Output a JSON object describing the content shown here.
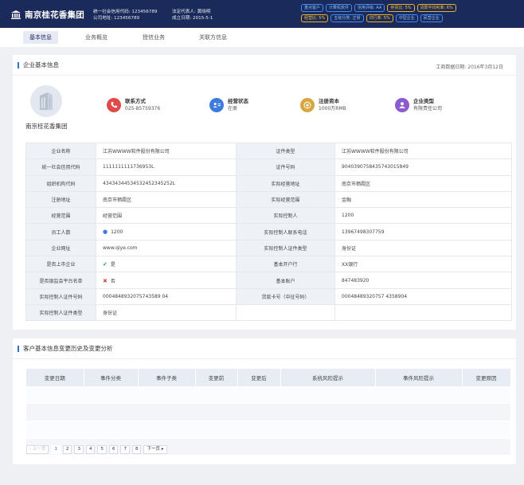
{
  "header": {
    "company": "南京桂花香集团",
    "credit_code": "统一社会信用代码: 123456789",
    "company_id": "公司地址: 123456789",
    "legal_rep": "法定代表人: 黄晓明",
    "founded": "成立日期: 2015-5-1",
    "tags_row1": [
      "重点客户",
      "计算机软件",
      "信用评级: AA",
      "存货比: 5%",
      "贷款平均利率: 6%"
    ],
    "tags_row2": [
      "经营比: 5%",
      "五级分类: 正常",
      "归行率: 5%",
      "中型企业",
      "民营企业"
    ]
  },
  "tabs": [
    "基本信息",
    "业务概览",
    "授信业务",
    "关联方信息"
  ],
  "basic": {
    "title": "企业基本信息",
    "date": "工商数据日期: 2016年3月12日",
    "company_name": "南京桂花香集团",
    "summary": [
      {
        "label": "联系方式",
        "value": "025-85759376",
        "color": "#e24a4a",
        "icon": "phone-icon"
      },
      {
        "label": "经营状态",
        "value": "在册",
        "color": "#3e7be0",
        "icon": "id-card-icon"
      },
      {
        "label": "注册资本",
        "value": "1000万RMB",
        "color": "#d8a640",
        "icon": "money-icon"
      },
      {
        "label": "企业类型",
        "value": "有限责任公司",
        "color": "#8a5ccf",
        "icon": "user-icon"
      }
    ],
    "rows": [
      [
        "企业名称",
        "江苏WWWW软件股份有限公司",
        "证件类型",
        "江苏WWWW软件股份有限公司"
      ],
      [
        "统一社会信用代码",
        "1111111111736953L",
        "证件号码",
        "9040390758435743015849"
      ],
      [
        "组织机构代码",
        "43434344534532452345252L",
        "实际经营地址",
        "南京市栖霞区"
      ],
      [
        "注册地址",
        "南京市栖霞区",
        "实际经营范围",
        "金融"
      ],
      [
        "经营范围",
        "经营范围",
        "实际控制人",
        "1200"
      ],
      [
        "员工人数",
        "1200",
        "实际控制人联系电话",
        "13967498307759"
      ],
      [
        "企业网址",
        "www.qiye.com",
        "实际控制人证件类型",
        "身份证"
      ],
      [
        "是否上市企业",
        "是",
        "基本开户行",
        "XX银行"
      ],
      [
        "是否银监会平台名单",
        "否",
        "基本账户",
        "847483920"
      ],
      [
        "实际控制人证件号码",
        "0004848932075743589 04",
        "贷款卡号（中征号码）",
        "00048489320757 4358904"
      ],
      [
        "实际控制人证件类型",
        "身份证",
        "",
        ""
      ]
    ]
  },
  "history": {
    "title": "客户基本信息变更历史及变更分析",
    "columns": [
      "变更日期",
      "事件分类",
      "事件子类",
      "变更前",
      "变更后",
      "系统风险提示",
      "事件风险提示",
      "变更原因"
    ],
    "pager": {
      "prev": "上一页",
      "pages": [
        "1",
        "2",
        "3",
        "4",
        "5",
        "6",
        "7",
        "8"
      ],
      "next": "下一页"
    }
  }
}
